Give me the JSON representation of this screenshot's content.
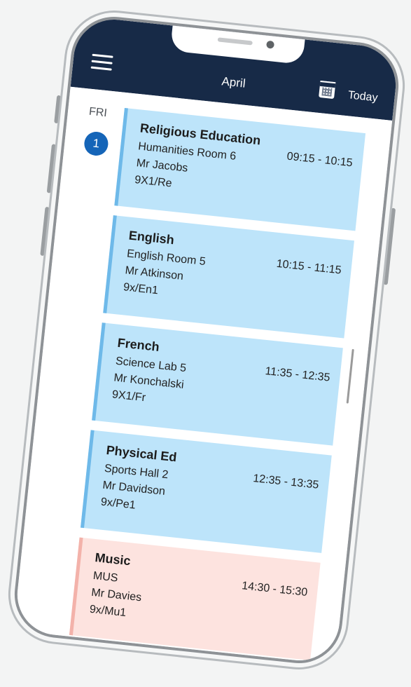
{
  "header": {
    "title": "April",
    "today_label": "Today"
  },
  "day": {
    "label": "FRI",
    "number": "1"
  },
  "events": [
    {
      "title": "Religious Education",
      "room": "Humanities Room 6",
      "teacher": "Mr Jacobs",
      "group": "9X1/Re",
      "time": "09:15 - 10:15"
    },
    {
      "title": "English",
      "room": "English Room 5",
      "teacher": "Mr Atkinson",
      "group": "9x/En1",
      "time": "10:15 - 11:15"
    },
    {
      "title": "French",
      "room": "Science Lab 5",
      "teacher": "Mr Konchalski",
      "group": "9X1/Fr",
      "time": "11:35 - 12:35"
    },
    {
      "title": "Physical Ed",
      "room": "Sports Hall 2",
      "teacher": "Mr Davidson",
      "group": "9x/Pe1",
      "time": "12:35 - 13:35"
    },
    {
      "title": "Music",
      "room": "MUS",
      "teacher": "Mr Davies",
      "group": "9x/Mu1",
      "time": "14:30 - 15:30"
    }
  ],
  "colors": {
    "header_bg": "#172a47",
    "event_blue": "#bde4fa",
    "event_pink": "#fde3df",
    "badge": "#1565b8"
  },
  "icons": {
    "menu": "hamburger-menu-icon",
    "calendar": "calendar-icon"
  }
}
